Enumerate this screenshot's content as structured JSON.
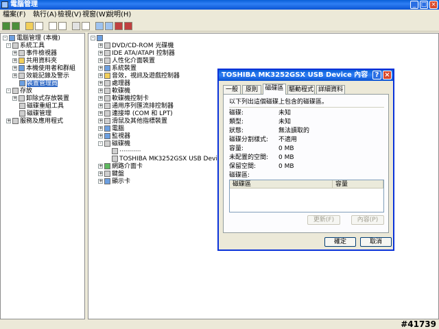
{
  "window": {
    "title": "電腦管理",
    "buttons": {
      "minimize": "_",
      "maximize": "□",
      "close": "×"
    }
  },
  "menu": [
    "檔案(F)",
    "執行(A)",
    "檢視(V)",
    "視窗(W)",
    "說明(H)"
  ],
  "left_tree": [
    {
      "label": "電腦管理 (本機)",
      "level": 0,
      "icon": "computer-icon"
    },
    {
      "label": "系統工具",
      "level": 1,
      "icon": "tools-icon"
    },
    {
      "label": "事件檢視器",
      "level": 2,
      "icon": "event-viewer-icon"
    },
    {
      "label": "共用資料夾",
      "level": 2,
      "icon": "shared-folder-icon"
    },
    {
      "label": "本機使用者和群組",
      "level": 2,
      "icon": "users-icon"
    },
    {
      "label": "效能記錄及警示",
      "level": 2,
      "icon": "performance-icon"
    },
    {
      "label": "裝置管理員",
      "level": 2,
      "icon": "device-manager-icon",
      "selected": true
    },
    {
      "label": "存放",
      "level": 1,
      "icon": "storage-icon"
    },
    {
      "label": "卸除式存放裝置",
      "level": 2,
      "icon": "removable-storage-icon"
    },
    {
      "label": "磁碟重組工具",
      "level": 2,
      "icon": "defrag-icon"
    },
    {
      "label": "磁碟管理",
      "level": 2,
      "icon": "disk-management-icon"
    },
    {
      "label": "服務及應用程式",
      "level": 1,
      "icon": "services-icon"
    }
  ],
  "device_tree": [
    {
      "label": "",
      "level": 0,
      "icon": "computer-icon"
    },
    {
      "label": "DVD/CD-ROM 光碟機",
      "level": 1,
      "icon": "cdrom-icon"
    },
    {
      "label": "IDE ATA/ATAPI 控制器",
      "level": 1,
      "icon": "ide-icon"
    },
    {
      "label": "人性化介面裝置",
      "level": 1,
      "icon": "hid-icon"
    },
    {
      "label": "系統裝置",
      "level": 1,
      "icon": "system-icon"
    },
    {
      "label": "音效，視訊及遊戲控制器",
      "level": 1,
      "icon": "sound-icon"
    },
    {
      "label": "處理器",
      "level": 1,
      "icon": "processor-icon"
    },
    {
      "label": "軟碟機",
      "level": 1,
      "icon": "floppy-icon"
    },
    {
      "label": "軟碟機控制卡",
      "level": 1,
      "icon": "floppy-controller-icon"
    },
    {
      "label": "通用序列匯流排控制器",
      "level": 1,
      "icon": "usb-icon"
    },
    {
      "label": "連接埠 (COM 和 LPT)",
      "level": 1,
      "icon": "port-icon"
    },
    {
      "label": "滑鼠及其他指標裝置",
      "level": 1,
      "icon": "mouse-icon"
    },
    {
      "label": "電腦",
      "level": 1,
      "icon": "computer-icon"
    },
    {
      "label": "監視器",
      "level": 1,
      "icon": "monitor-icon"
    },
    {
      "label": "磁碟機",
      "level": 1,
      "icon": "disk-icon",
      "expanded": true
    },
    {
      "label": "···········",
      "level": 2,
      "icon": "disk-icon"
    },
    {
      "label": "TOSHIBA MK3252GSX USB Device",
      "level": 2,
      "icon": "disk-icon"
    },
    {
      "label": "網路介面卡",
      "level": 1,
      "icon": "network-icon"
    },
    {
      "label": "鍵盤",
      "level": 1,
      "icon": "keyboard-icon"
    },
    {
      "label": "顯示卡",
      "level": 1,
      "icon": "display-icon"
    }
  ],
  "dialog": {
    "title": "TOSHIBA MK3252GSX USB Device 內容",
    "help": "?",
    "close": "×",
    "tabs": [
      "一般",
      "原則",
      "磁碟區",
      "驅動程式",
      "詳細資料"
    ],
    "active_tab": 2,
    "intro": "以下列出這個磁碟上包含的磁碟區。",
    "fields": [
      {
        "label": "磁碟:",
        "value": "未知"
      },
      {
        "label": "類型:",
        "value": "未知"
      },
      {
        "label": "狀態:",
        "value": "無法讀取的"
      },
      {
        "label": "磁碟分割樣式:",
        "value": "不適用"
      },
      {
        "label": "容量:",
        "value": "0 MB"
      },
      {
        "label": "未配置的空間:",
        "value": "0 MB"
      },
      {
        "label": "保留空間:",
        "value": "0 MB"
      }
    ],
    "volumes_label": "磁碟區:",
    "columns": [
      "磁碟區",
      "容量"
    ],
    "refresh": "更新(F)",
    "properties": "內容(P)",
    "ok": "確定",
    "cancel": "取消"
  },
  "watermark": "#41739"
}
